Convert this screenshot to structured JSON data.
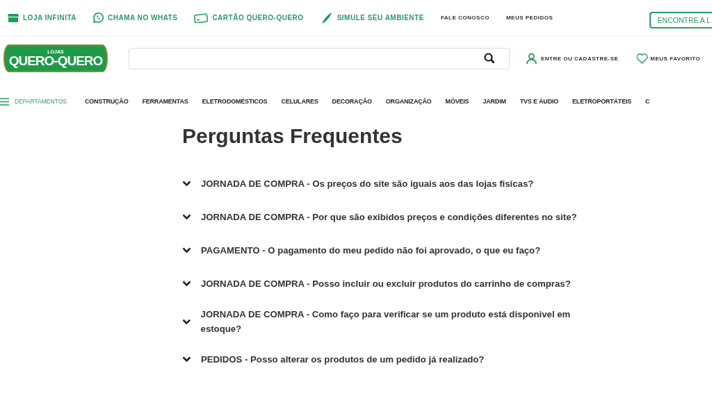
{
  "top_links": [
    {
      "label": "LOJA INFINITA",
      "kind": "store"
    },
    {
      "label": "CHAMA NO WHATS",
      "kind": "whatsapp"
    },
    {
      "label": "CARTÃO QUERO-QUERO",
      "kind": "card"
    },
    {
      "label": "SIMULE SEU AMBIENTE",
      "kind": "brush"
    },
    {
      "label": "FALE CONOSCO",
      "kind": "plain"
    },
    {
      "label": "MEUS PEDIDOS",
      "kind": "plain"
    }
  ],
  "store_button": "ENCONTRE A L",
  "logo": {
    "small": "LOJAS",
    "main": "QUERO-QUERO"
  },
  "account_link": "ENTRE OU CADASTRE-SE",
  "favorites_link": "MEUS FAVORITO",
  "departments": "DEPARTAMENTOS",
  "nav": [
    "CONSTRUÇÃO",
    "FERRAMENTAS",
    "ELETRODOMÉSTICOS",
    "CELULARES",
    "DECORAÇÃO",
    "ORGANIZAÇÃO",
    "MÓVEIS",
    "JARDIM",
    "TVS E ÁUDIO",
    "ELETROPORTÁTEIS",
    "C"
  ],
  "title": "Perguntas Frequentes",
  "faq": [
    {
      "question": "JORNADA DE COMPRA - Os preços do site são iguais aos das lojas fisicas?",
      "expanded": false
    },
    {
      "question": "JORNADA DE COMPRA - Por que são exibidos preços e condições diferentes no site?",
      "expanded": false
    },
    {
      "question": "PAGAMENTO - O pagamento do meu pedido não foi aprovado, o que eu faço?",
      "expanded": false
    },
    {
      "question": "JORNADA DE COMPRA - Posso incluir ou excluir produtos do carrinho de compras?",
      "expanded": false
    },
    {
      "question": "JORNADA DE COMPRA - Como faço para verificar se um produto está disponivel em estoque?",
      "expanded": false
    },
    {
      "question": "PEDIDOS - Posso alterar os produtos de um pedido já realizado?",
      "expanded": false
    }
  ]
}
